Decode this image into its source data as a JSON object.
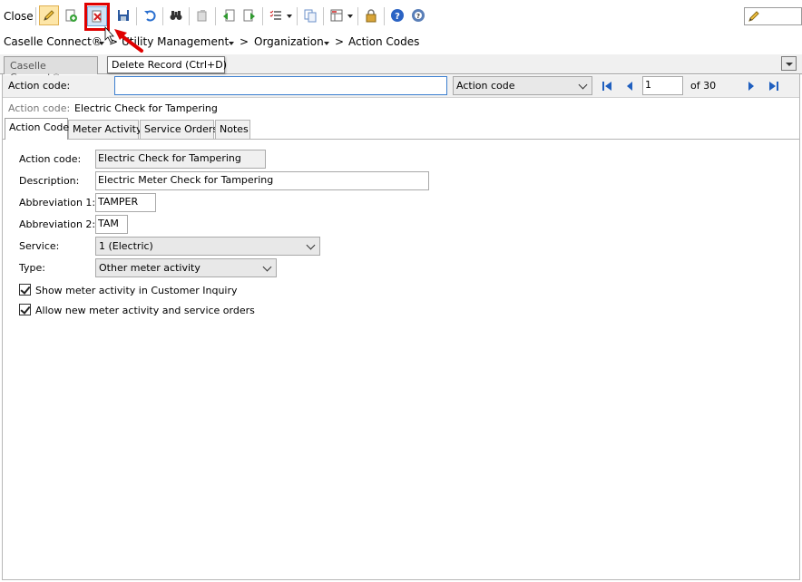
{
  "toolbar": {
    "close_label": "Close",
    "icons": [
      "edit-pencil",
      "add-record",
      "delete-record",
      "save",
      "undo",
      "find-binoculars",
      "copy",
      "import",
      "export",
      "list-options",
      "copy-pages",
      "layout-options",
      "lock",
      "help",
      "help-about"
    ]
  },
  "breadcrumb": {
    "items": [
      "Caselle Connect®",
      "Utility Management",
      "Organization",
      "Action Codes"
    ],
    "separator": ">"
  },
  "doc_tab": {
    "label": "Caselle Connect®"
  },
  "tooltip": {
    "text": "Delete Record (Ctrl+D)"
  },
  "lookup": {
    "label": "Action code:",
    "value": "",
    "search_field": "Action code",
    "record_number": "1",
    "record_total": "of 30"
  },
  "current_record": {
    "label": "Action code:",
    "value": "Electric Check for Tampering"
  },
  "tabs": [
    "Action Code",
    "Meter Activity",
    "Service Orders",
    "Notes"
  ],
  "form": {
    "action_code_label": "Action code:",
    "action_code_value": "Electric Check for Tampering",
    "description_label": "Description:",
    "description_value": "Electric Meter Check for Tampering",
    "abbrev1_label": "Abbreviation 1:",
    "abbrev1_value": "TAMPER",
    "abbrev2_label": "Abbreviation 2:",
    "abbrev2_value": "TAM",
    "service_label": "Service:",
    "service_value": "1 (Electric)",
    "type_label": "Type:",
    "type_value": "Other meter activity",
    "check1_label": "Show meter activity in Customer Inquiry",
    "check1_checked": true,
    "check2_label": "Allow new meter activity and service orders",
    "check2_checked": true
  },
  "colors": {
    "highlight": "#e00000",
    "arrow": "#e00000",
    "nav_blue": "#1f5fbf"
  }
}
